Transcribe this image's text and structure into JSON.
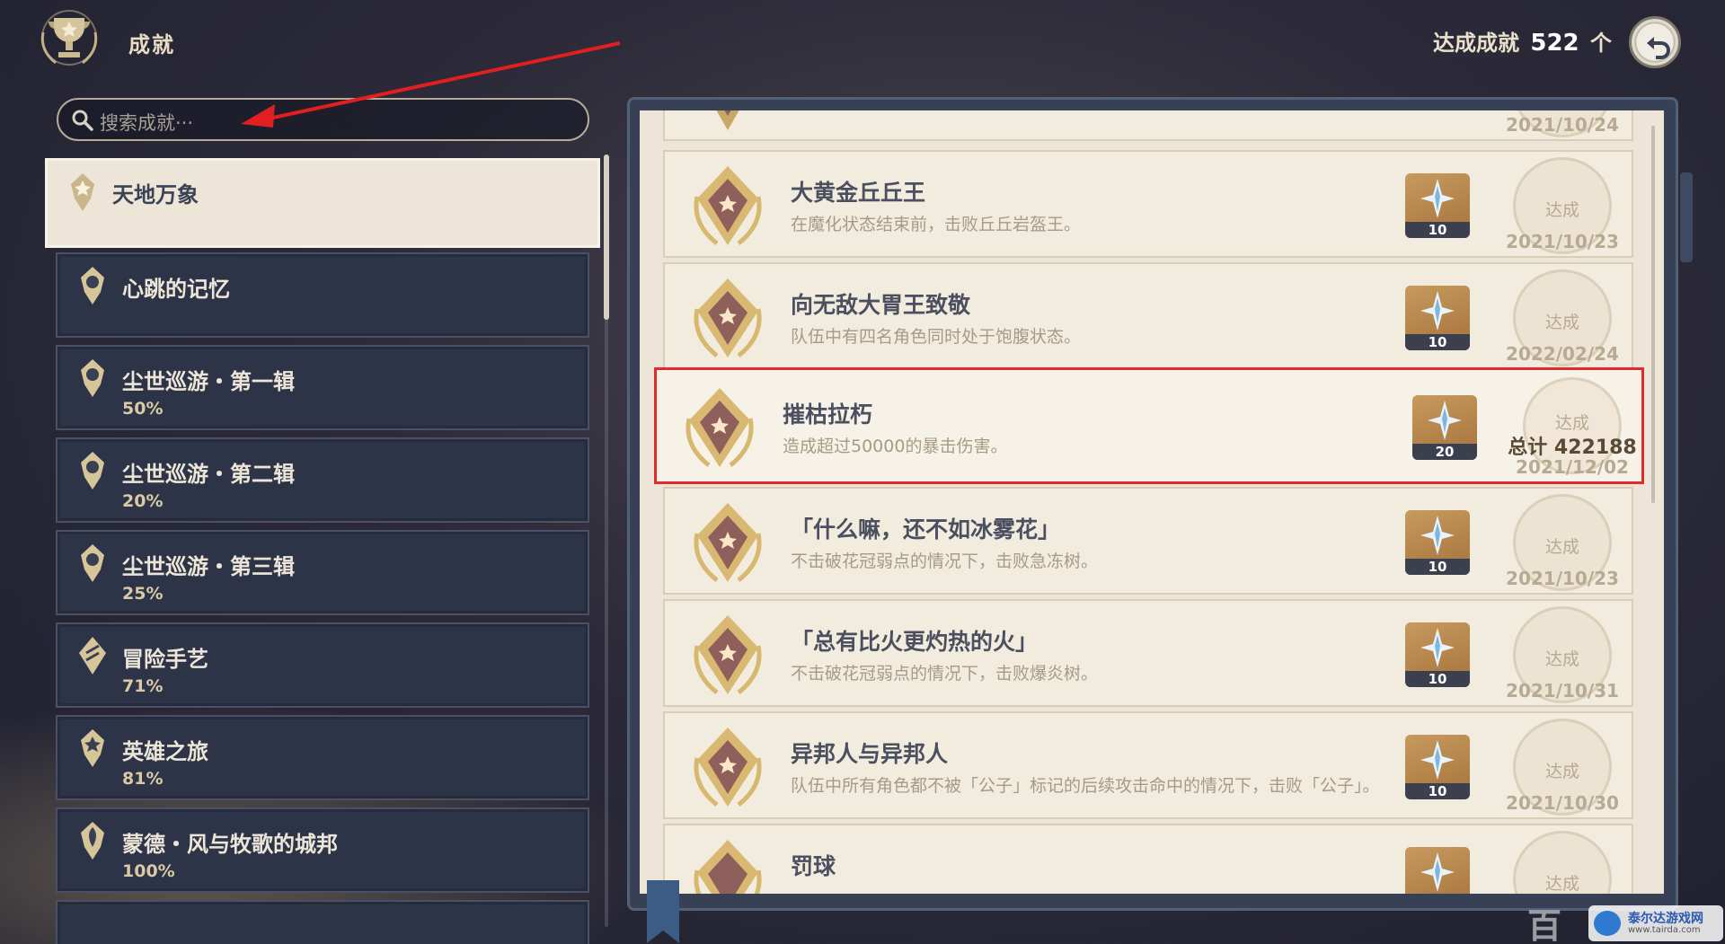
{
  "header": {
    "title": "成就",
    "count_prefix": "达成成就",
    "count_value": "522",
    "count_unit": "个"
  },
  "search": {
    "placeholder": "搜索成就···"
  },
  "categories": [
    {
      "name": "天地万象",
      "progress": "",
      "selected": true
    },
    {
      "name": "心跳的记忆",
      "progress": ""
    },
    {
      "name": "尘世巡游・第一辑",
      "progress": "50%"
    },
    {
      "name": "尘世巡游・第二辑",
      "progress": "20%"
    },
    {
      "name": "尘世巡游・第三辑",
      "progress": "25%"
    },
    {
      "name": "冒险手艺",
      "progress": "71%"
    },
    {
      "name": "英雄之旅",
      "progress": "81%"
    },
    {
      "name": "蒙德・风与牧歌的城邦",
      "progress": "100%"
    }
  ],
  "achievements": [
    {
      "name": "",
      "desc": "",
      "reward": "",
      "status": "",
      "date": "2021/10/24"
    },
    {
      "name": "大黄金丘丘王",
      "desc": "在魔化状态结束前，击败丘丘岩盔王。",
      "reward": "10",
      "status": "达成",
      "date": "2021/10/23"
    },
    {
      "name": "向无敌大胃王致敬",
      "desc": "队伍中有四名角色同时处于饱腹状态。",
      "reward": "10",
      "status": "达成",
      "date": "2022/02/24"
    },
    {
      "name": "摧枯拉朽",
      "desc": "造成超过50000的暴击伤害。",
      "reward": "20",
      "status": "达成",
      "total": "总计 422188",
      "date": "2021/12/02",
      "highlighted": true
    },
    {
      "name": "「什么嘛，还不如冰雾花」",
      "desc": "不击破花冠弱点的情况下，击败急冻树。",
      "reward": "10",
      "status": "达成",
      "date": "2021/10/23"
    },
    {
      "name": "「总有比火更灼热的火」",
      "desc": "不击破花冠弱点的情况下，击败爆炎树。",
      "reward": "10",
      "status": "达成",
      "date": "2021/10/31"
    },
    {
      "name": "异邦人与异邦人",
      "desc": "队伍中所有角色都不被「公子」标记的后续攻击命中的情况下，击败「公子」。",
      "reward": "10",
      "status": "达成",
      "date": "2021/10/30"
    },
    {
      "name": "罚球",
      "desc": "",
      "reward": "",
      "status": "达成",
      "date": ""
    }
  ],
  "watermark": {
    "text": "百",
    "site": "泰尔达游戏网",
    "url": "www.tairda.com"
  },
  "colors": {
    "highlight_border": "#e32a2a",
    "annotation_arrow": "#e02020",
    "page_bg": "#ece5d8",
    "sidebar_item_bg": "#2d3447"
  }
}
